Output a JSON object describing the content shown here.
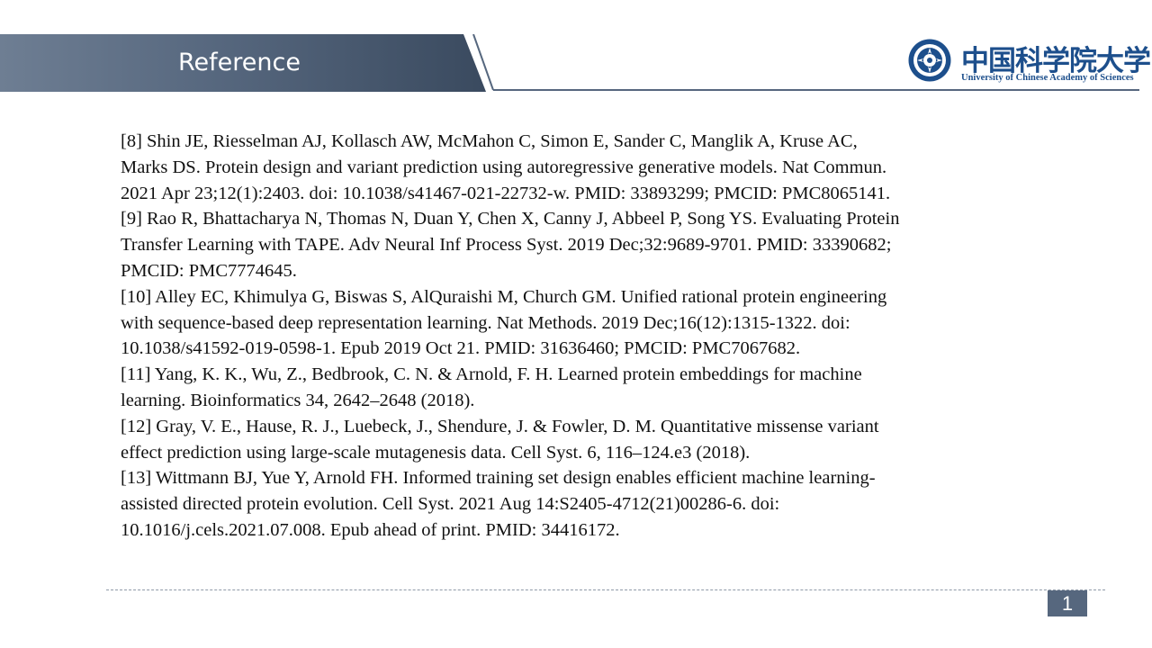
{
  "slide": {
    "title": "Reference",
    "page_number": "1"
  },
  "logo": {
    "chinese_name": "中国科学院大学",
    "english_name": "University of Chinese Academy of Sciences"
  },
  "references": [
    {
      "lines": [
        "[8] Shin JE, Riesselman AJ, Kollasch AW, McMahon C, Simon E, Sander C, Manglik A, Kruse AC,",
        "Marks DS. Protein design and variant prediction using autoregressive generative models. Nat Commun.",
        "2021 Apr 23;12(1):2403. doi: 10.1038/s41467-021-22732-w. PMID: 33893299; PMCID: PMC8065141."
      ]
    },
    {
      "lines": [
        "[9] Rao R, Bhattacharya N, Thomas N, Duan Y, Chen X, Canny J, Abbeel P, Song YS. Evaluating Protein",
        "Transfer Learning with TAPE. Adv Neural Inf Process Syst. 2019 Dec;32:9689-9701. PMID: 33390682;",
        "PMCID: PMC7774645."
      ]
    },
    {
      "lines": [
        "[10] Alley EC, Khimulya G, Biswas S, AlQuraishi M, Church GM. Unified rational protein engineering",
        "with sequence-based deep representation learning. Nat Methods. 2019 Dec;16(12):1315-1322. doi:",
        "10.1038/s41592-019-0598-1. Epub 2019 Oct 21. PMID: 31636460; PMCID: PMC7067682."
      ]
    },
    {
      "lines": [
        "[11] Yang, K. K., Wu, Z., Bedbrook, C. N. & Arnold, F. H. Learned protein embeddings for machine",
        "learning. Bioinformatics 34, 2642–2648 (2018)."
      ]
    },
    {
      "lines": [
        "[12] Gray, V. E., Hause, R. J., Luebeck, J., Shendure, J. & Fowler, D. M. Quantitative missense variant",
        "effect prediction using large-scale mutagenesis data. Cell Syst. 6, 116–124.e3 (2018)."
      ]
    },
    {
      "lines": [
        "[13] Wittmann BJ, Yue Y, Arnold FH. Informed training set design enables efficient machine learning-",
        "assisted directed protein evolution. Cell Syst. 2021 Aug 14:S2405-4712(21)00286-6. doi:",
        "10.1016/j.cels.2021.07.008. Epub ahead of print. PMID: 34416172."
      ]
    }
  ],
  "colors": {
    "header_band": "#56677e",
    "logo_blue": "#1d4f8c",
    "page_badge": "#56677e",
    "text": "#111111"
  }
}
